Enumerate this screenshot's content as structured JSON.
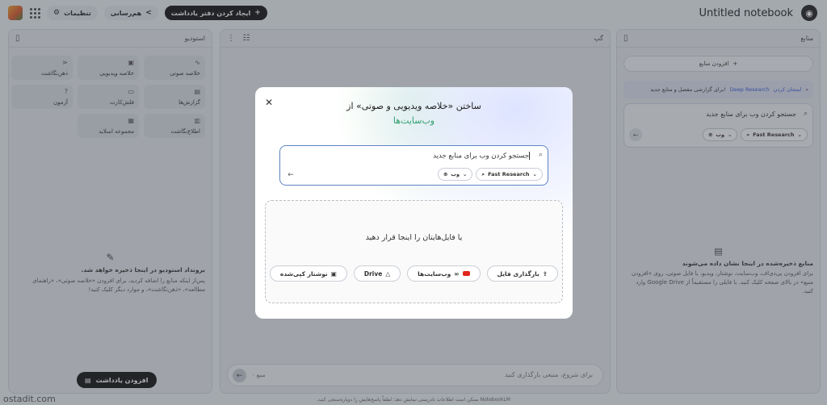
{
  "topbar": {
    "notebook_title": "Untitled notebook",
    "new_notebook_label": "ایجاد کردن دفتر یادداشت",
    "share_label": "هم‌رسانی",
    "settings_label": "تنظیمات"
  },
  "studio": {
    "title": "استودیو",
    "tiles": [
      {
        "label": "خلاصه صوتی",
        "icon": "audio-icon"
      },
      {
        "label": "خلاصه ویدیویی",
        "icon": "video-icon"
      },
      {
        "label": "ذهن‌نگاشت",
        "icon": "mindmap-icon"
      },
      {
        "label": "گزارش‌ها",
        "icon": "report-icon"
      },
      {
        "label": "فلش‌کارت",
        "icon": "flashcard-icon"
      },
      {
        "label": "آزمون",
        "icon": "quiz-icon"
      },
      {
        "label": "اطلاع‌نگاشت",
        "icon": "infographic-icon"
      },
      {
        "label": "مجموعه اسلاید",
        "icon": "slides-icon"
      }
    ],
    "empty_title": "برونداد استودیو در اینجا ذخیره خواهد شد.",
    "empty_desc": "پس‌از اینکه منابع را اضافه کردید، برای افزودن «خلاصه صوتی»، «راهنمای مطالعه»، «ذهن‌نگاشت»، و موارد دیگر کلیک کنید!",
    "add_note_label": "افزودن یادداشت"
  },
  "chat": {
    "title": "گپ",
    "input_placeholder": "برای شروع، منبعی بارگذاری کنید",
    "source_count": "۰ منبع"
  },
  "sources": {
    "title": "منابع",
    "add_label": "افزودن منابع",
    "deep_link": "Deep Research",
    "deep_prefix": "امتحان کردن",
    "deep_suffix": "برای گزارشی مفصل و منابع جدید!",
    "search_query": "جستجو کردن وب برای منابع جدید",
    "web_chip": "وب",
    "research_chip": "Fast Research",
    "empty_title": "منابع ذخیره‌شده در اینجا نشان داده می‌شوند",
    "empty_desc": "برای افزودن پی‌دی‌اف، وب‌سایت، نوشتار، ویدیو، یا فایل صوتی، روی «افزودن منبع» در بالای صفحه کلیک کنید. یا فایلی را مستقیماً از Google Drive وارد کنید."
  },
  "modal": {
    "title": "ساختن «خلاصه ویدیویی و صوتی» از",
    "subtitle": "وب‌سایت‌ها",
    "search_query": "جستجو کردن وب برای منابع جدید",
    "web_chip": "وب",
    "research_chip": "Fast Research",
    "drop_text": "یا فایل‌هایتان را اینجا قرار دهید",
    "buttons": {
      "upload": "بارگذاری فایل",
      "websites": "وب‌سایت‌ها",
      "drive": "Drive",
      "paste": "نوشتار کپی‌شده"
    }
  },
  "footer": {
    "disclaimer": "NotebookLM ممکن است اطلاعات نادرستی نمایش دهد؛ لطفاً پاسخ‌هایش را دوباره‌سنجی کنید.",
    "watermark": "ostadit.com"
  }
}
